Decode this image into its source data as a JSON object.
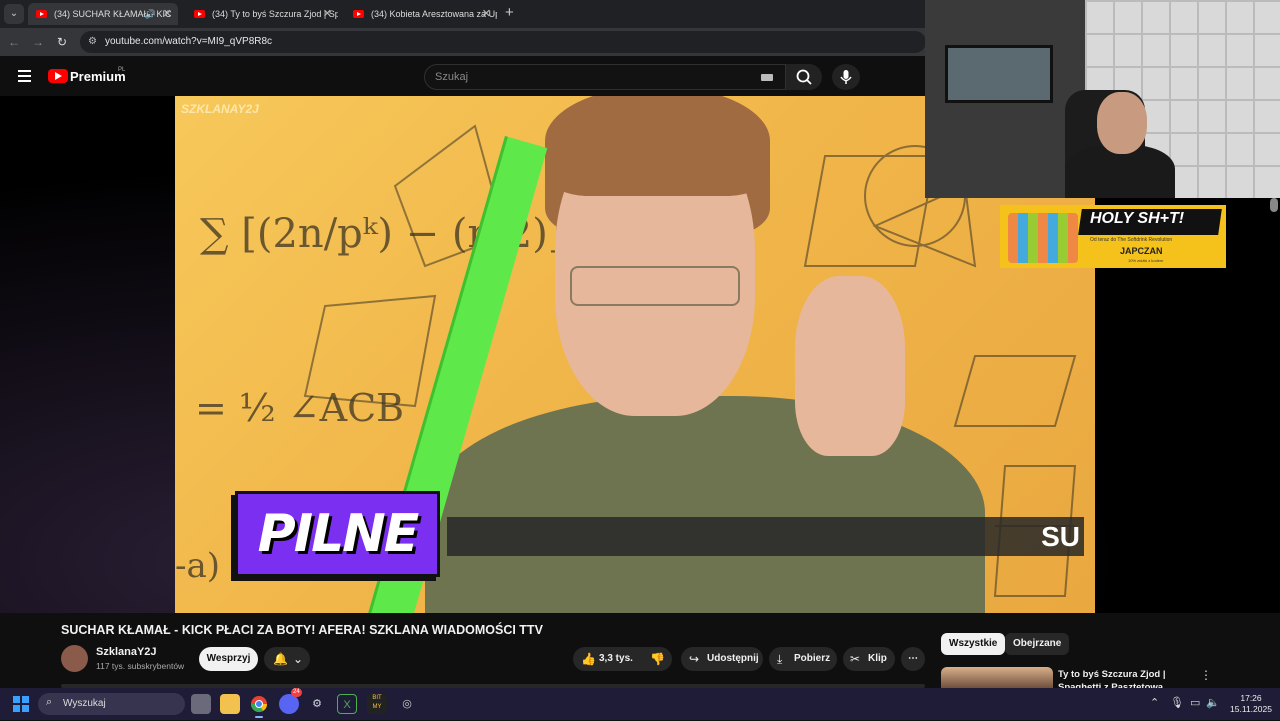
{
  "browser": {
    "tabs": [
      {
        "title": "(34) SUCHAR KŁAMAŁ - KIC",
        "active": true,
        "audio": true
      },
      {
        "title": "(34) Ty to byś Szczura Zjod | Sp",
        "active": false
      },
      {
        "title": "(34) Kobieta Aresztowana za Up",
        "active": false
      }
    ],
    "url": "youtube.com/watch?v=MI9_qVP8R8c"
  },
  "masthead": {
    "brand": "Premium",
    "region": "PL",
    "search_placeholder": "Szukaj"
  },
  "video": {
    "thumbnail_watermark": "SZKLANAY2J",
    "banner_text": "PILNE",
    "ticker_text": "SU",
    "title": "SUCHAR KŁAMAŁ - KICK PŁACI ZA BOTY! AFERA! SZKLANA WIADOMOŚCI TTV"
  },
  "overlay_ad": {
    "headline": "HOLY SH+T!",
    "subline": "Od teraz do The Softdrink Revolution",
    "brand": "JAPCZAN",
    "promo": "10% zniżki z kodem"
  },
  "channel": {
    "name": "SzklanaY2J",
    "subscribers": "117 tys. subskrybentów",
    "support_label": "Wesprzyj"
  },
  "actions": {
    "likes": "3,3 tys.",
    "share": "Udostępnij",
    "download": "Pobierz",
    "clip": "Klip"
  },
  "sidebar": {
    "chips": [
      "Wszystkie",
      "Obejrzane"
    ],
    "related": [
      {
        "title": "Ty to byś Szczura Zjod | Spaghetti z Pasztetowa"
      }
    ]
  },
  "taskbar": {
    "search_placeholder": "Wyszukaj",
    "discord_badge": "24",
    "time": "17:26",
    "date": "15.11.2025"
  },
  "colors": {
    "yt_red": "#ff0000",
    "banner_purple": "#7b2ff0",
    "ruler_green": "#5ee84a",
    "ad_yellow": "#f4c21a",
    "taskbar": "#1e1c36"
  }
}
